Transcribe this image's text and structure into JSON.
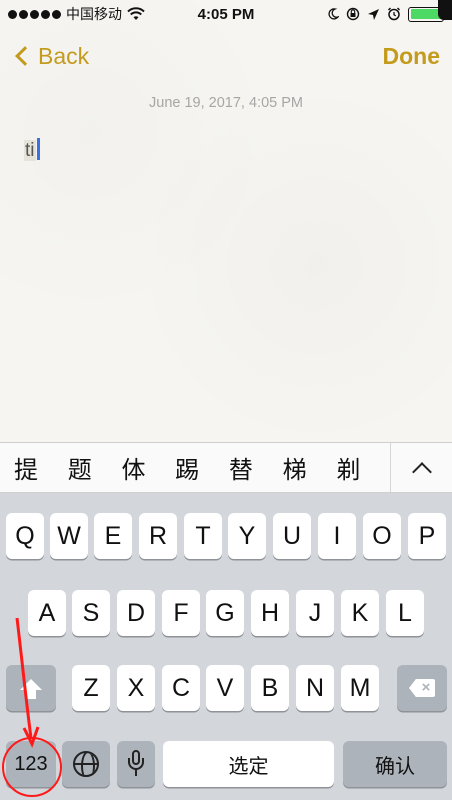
{
  "status_bar": {
    "carrier": "中国移动",
    "time": "4:05 PM",
    "signal_dots": 5,
    "battery_level": 1.0
  },
  "nav": {
    "back_label": "Back",
    "done_label": "Done"
  },
  "note": {
    "date": "June 19, 2017, 4:05 PM",
    "text": "ti"
  },
  "candidates": [
    "提",
    "题",
    "体",
    "踢",
    "替",
    "梯",
    "剃"
  ],
  "keyboard": {
    "row1": [
      "Q",
      "W",
      "E",
      "R",
      "T",
      "Y",
      "U",
      "I",
      "O",
      "P"
    ],
    "row2": [
      "A",
      "S",
      "D",
      "F",
      "G",
      "H",
      "J",
      "K",
      "L"
    ],
    "row3": [
      "Z",
      "X",
      "C",
      "V",
      "B",
      "N",
      "M"
    ],
    "numbers_label": "123",
    "space_label": "选定",
    "return_label": "确认"
  },
  "colors": {
    "accent": "#c39b1d",
    "annotation": "#ff1a1a",
    "cursor": "#3a70e0"
  }
}
